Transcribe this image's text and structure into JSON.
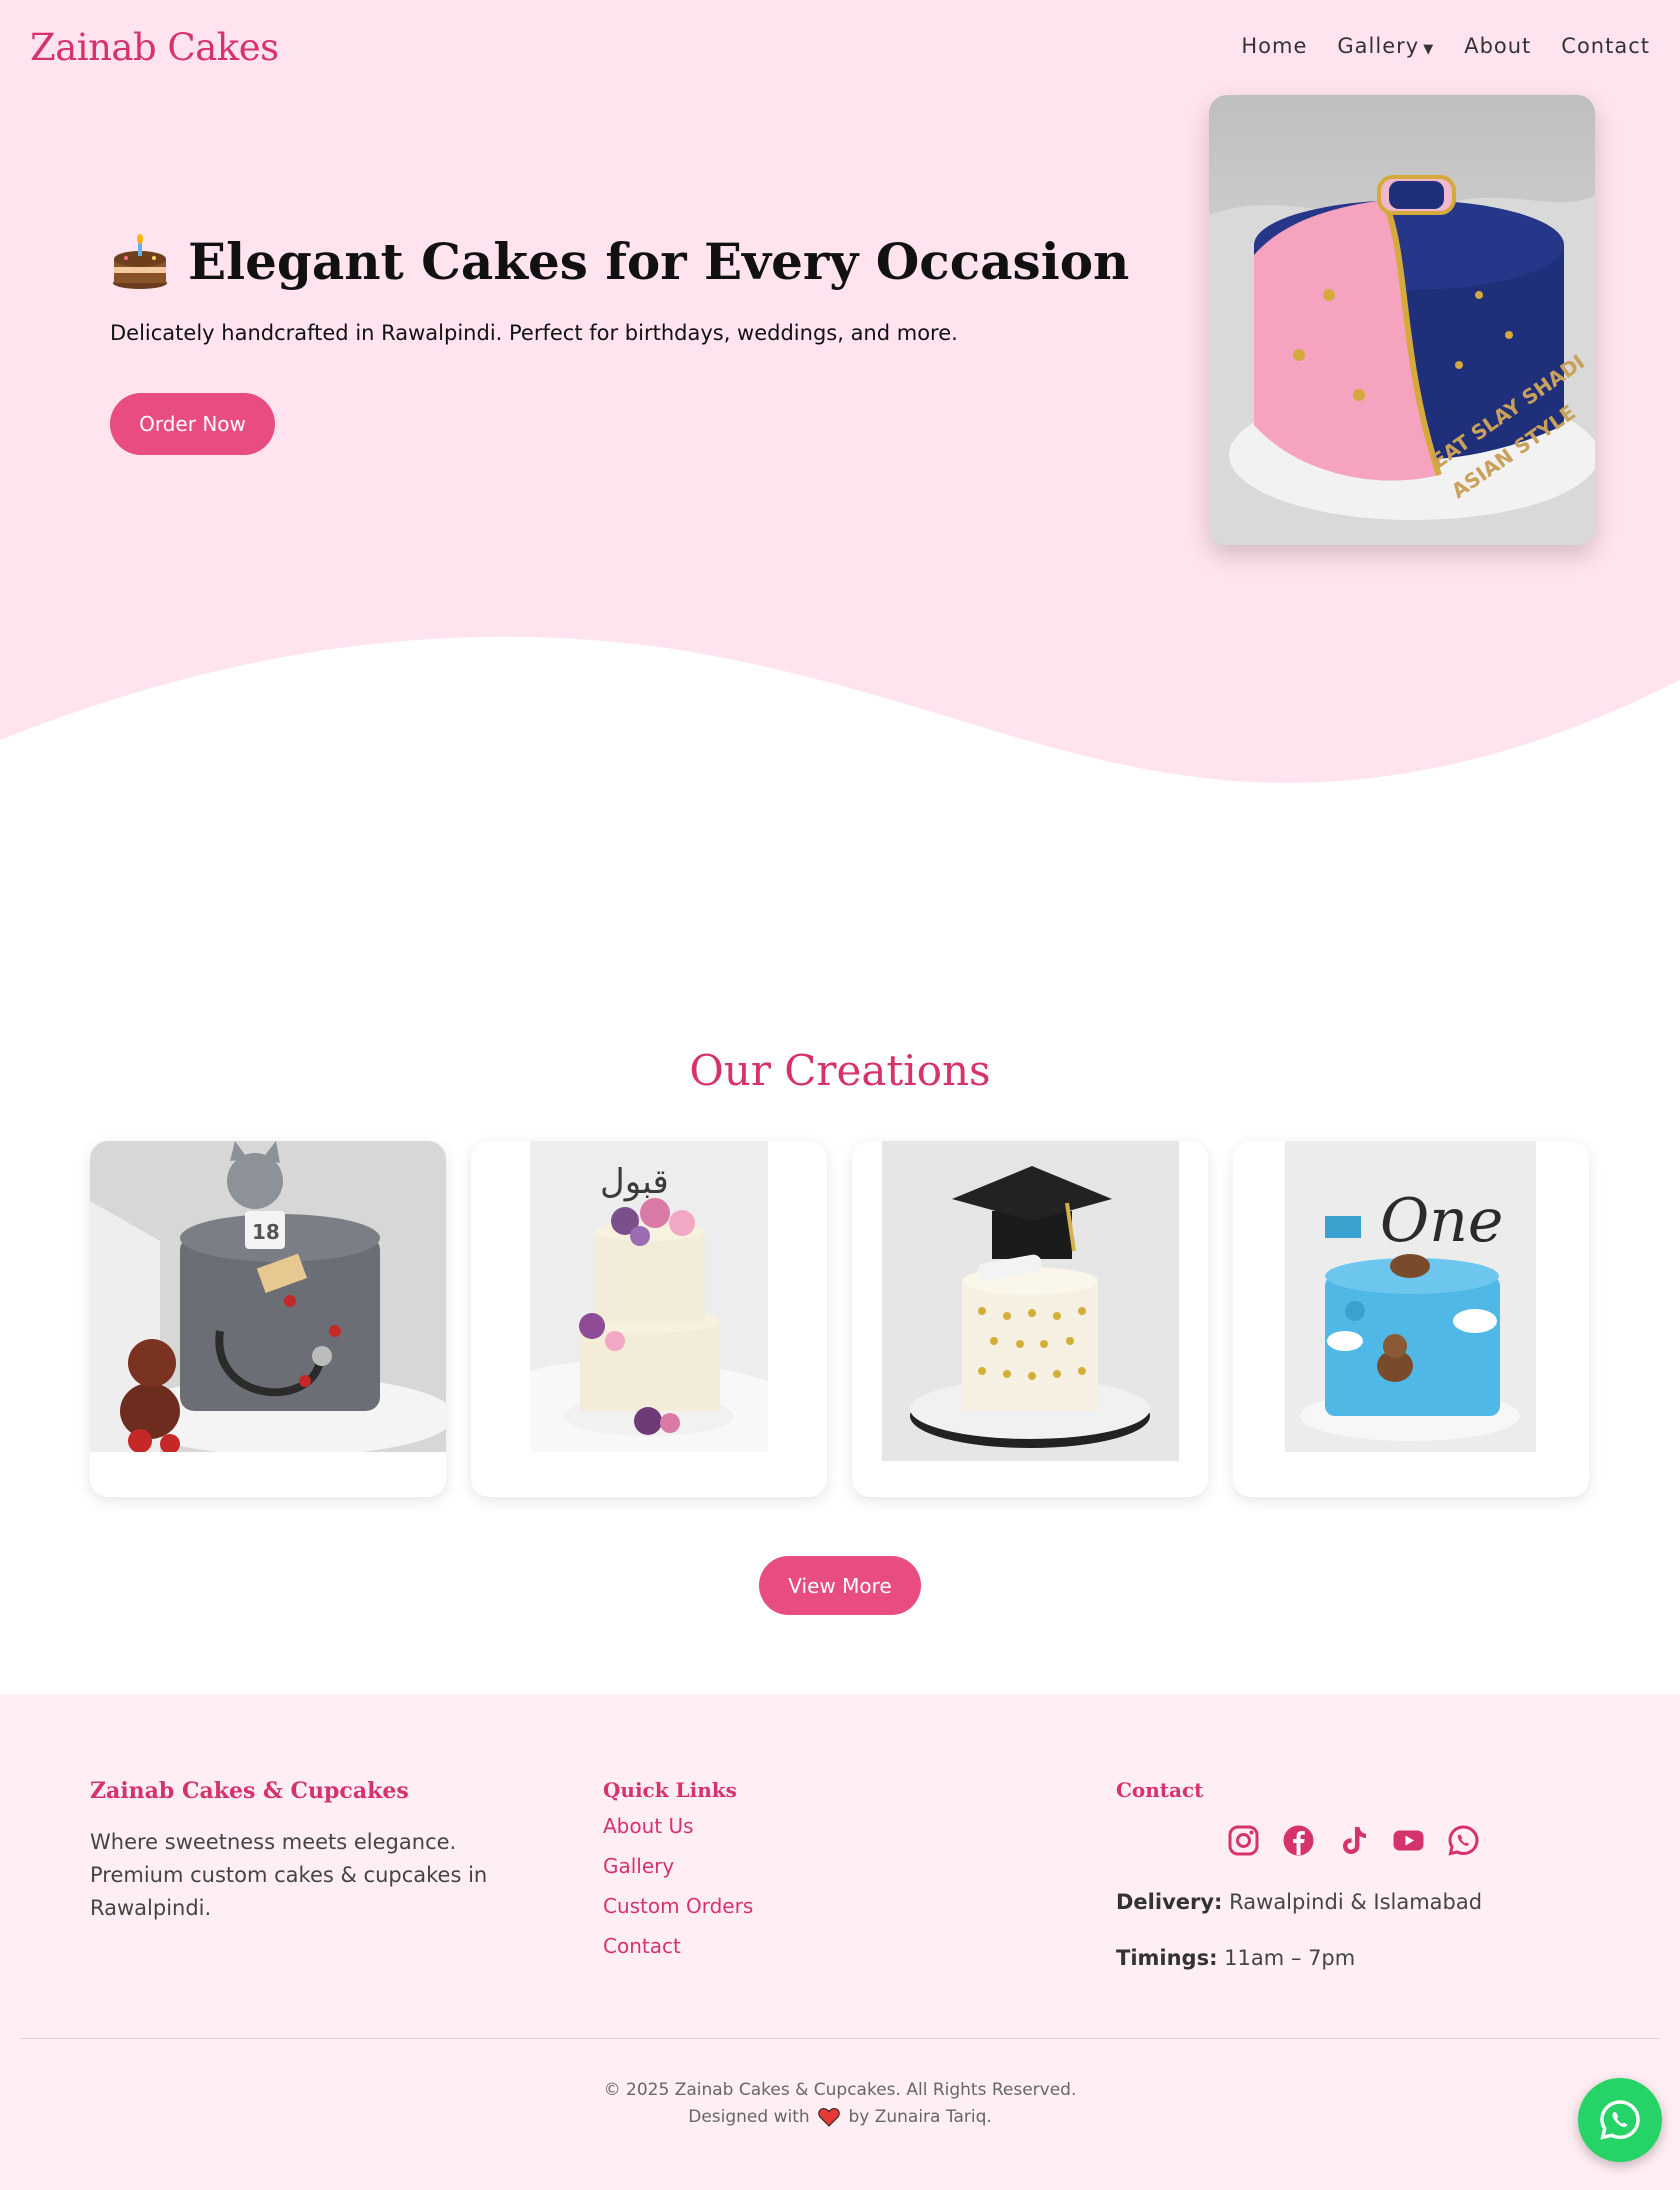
{
  "brand": {
    "logo": "Zainab Cakes"
  },
  "nav": {
    "items": [
      {
        "label": "Home"
      },
      {
        "label": "Gallery",
        "has_dropdown": true
      },
      {
        "label": "About"
      },
      {
        "label": "Contact"
      }
    ]
  },
  "hero": {
    "title": "Elegant Cakes for Every Occasion",
    "subtitle": "Delicately handcrafted in Rawalpindi. Perfect for birthdays, weddings, and more.",
    "order_button": "Order Now",
    "photo_text_line1": "EAT SLAY SHADI",
    "photo_text_line2": "ASIAN STYLE"
  },
  "creations": {
    "title": "Our Creations",
    "view_more_button": "View More",
    "cards": [
      {
        "name": "doctor-cake",
        "topper_number": "18"
      },
      {
        "name": "floral-cake",
        "topper_text": "قبول"
      },
      {
        "name": "graduation-cake"
      },
      {
        "name": "first-birthday-cake",
        "topper_text": "One"
      }
    ]
  },
  "footer": {
    "brand": "Zainab Cakes & Cupcakes",
    "description": "Where sweetness meets elegance. Premium custom cakes & cupcakes in Rawalpindi.",
    "quick_links_title": "Quick Links",
    "quick_links": [
      {
        "label": "About Us"
      },
      {
        "label": "Gallery"
      },
      {
        "label": "Custom Orders"
      },
      {
        "label": "Contact"
      }
    ],
    "contact_title": "Contact",
    "social_icons": [
      "instagram-icon",
      "facebook-icon",
      "tiktok-icon",
      "youtube-icon",
      "whatsapp-icon"
    ],
    "delivery_label": "Delivery:",
    "delivery_value": "Rawalpindi & Islamabad",
    "timings_label": "Timings:",
    "timings_value": "11am – 7pm",
    "copyright": "© 2025 Zainab Cakes & Cupcakes. All Rights Reserved.",
    "designed_prefix": "Designed with",
    "designed_suffix": "by Zunaira Tariq."
  },
  "colors": {
    "accent": "#d6336c",
    "button": "#e94c7e",
    "hero_bg": "#ffe3ee",
    "footer_bg": "#ffeef4",
    "whatsapp": "#25d366"
  }
}
